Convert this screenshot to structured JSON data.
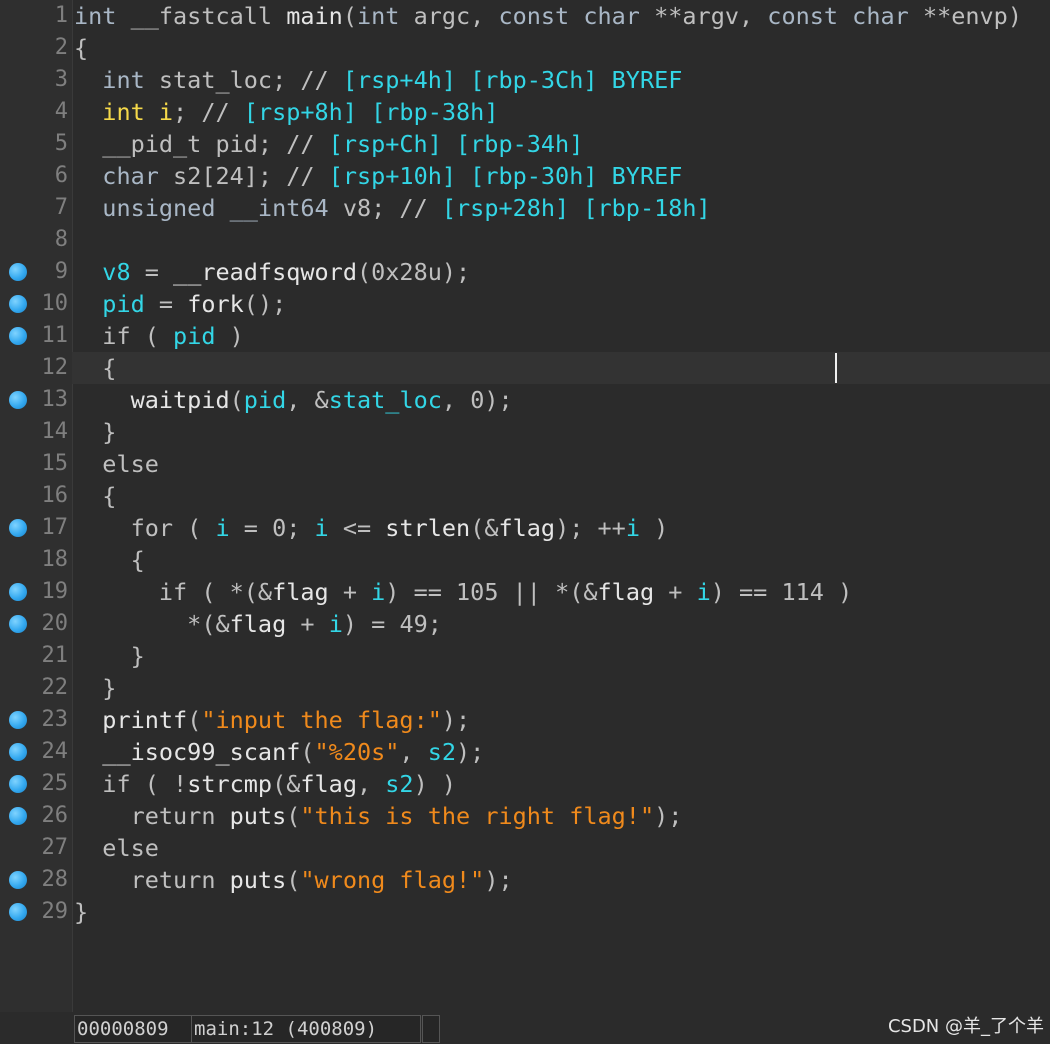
{
  "editor": {
    "lines": [
      {
        "n": "1",
        "bp": false,
        "tokens": [
          [
            "kw",
            "int "
          ],
          [
            "plain",
            "__fastcall "
          ],
          [
            "fn",
            "main"
          ],
          [
            "plain",
            "("
          ],
          [
            "kw",
            "int "
          ],
          [
            "plain",
            "argc, "
          ],
          [
            "kw",
            "const char "
          ],
          [
            "plain",
            "**argv, "
          ],
          [
            "kw",
            "const char "
          ],
          [
            "plain",
            "**envp)"
          ]
        ]
      },
      {
        "n": "2",
        "bp": false,
        "tokens": [
          [
            "plain",
            "{"
          ]
        ]
      },
      {
        "n": "3",
        "bp": false,
        "tokens": [
          [
            "plain",
            "  "
          ],
          [
            "kw",
            "int "
          ],
          [
            "plain",
            "stat_loc; // "
          ],
          [
            "addr",
            "[rsp+4h] [rbp-3Ch] BYREF"
          ]
        ]
      },
      {
        "n": "4",
        "bp": false,
        "tokens": [
          [
            "plain",
            "  "
          ],
          [
            "yel",
            "int i"
          ],
          [
            "plain",
            "; // "
          ],
          [
            "addr",
            "[rsp+8h] [rbp-38h]"
          ]
        ]
      },
      {
        "n": "5",
        "bp": false,
        "tokens": [
          [
            "plain",
            "  __pid_t pid; // "
          ],
          [
            "addr",
            "[rsp+Ch] [rbp-34h]"
          ]
        ]
      },
      {
        "n": "6",
        "bp": false,
        "tokens": [
          [
            "plain",
            "  "
          ],
          [
            "kw",
            "char "
          ],
          [
            "plain",
            "s2[24]; // "
          ],
          [
            "addr",
            "[rsp+10h] [rbp-30h] BYREF"
          ]
        ]
      },
      {
        "n": "7",
        "bp": false,
        "tokens": [
          [
            "plain",
            "  "
          ],
          [
            "kw",
            "unsigned __int64 "
          ],
          [
            "plain",
            "v8; // "
          ],
          [
            "addr",
            "[rsp+28h] [rbp-18h]"
          ]
        ]
      },
      {
        "n": "8",
        "bp": false,
        "tokens": []
      },
      {
        "n": "9",
        "bp": true,
        "tokens": [
          [
            "plain",
            "  "
          ],
          [
            "var",
            "v8"
          ],
          [
            "plain",
            " = "
          ],
          [
            "fn",
            "__readfsqword"
          ],
          [
            "plain",
            "("
          ],
          [
            "num",
            "0x28u"
          ],
          [
            "plain",
            ");"
          ]
        ]
      },
      {
        "n": "10",
        "bp": true,
        "tokens": [
          [
            "plain",
            "  "
          ],
          [
            "var",
            "pid"
          ],
          [
            "plain",
            " = "
          ],
          [
            "fn",
            "fork"
          ],
          [
            "plain",
            "();"
          ]
        ]
      },
      {
        "n": "11",
        "bp": true,
        "tokens": [
          [
            "plain",
            "  if ( "
          ],
          [
            "var",
            "pid"
          ],
          [
            "plain",
            " )"
          ]
        ]
      },
      {
        "n": "12",
        "bp": false,
        "tokens": [
          [
            "plain",
            "  {"
          ]
        ]
      },
      {
        "n": "13",
        "bp": true,
        "tokens": [
          [
            "plain",
            "    "
          ],
          [
            "fn",
            "waitpid"
          ],
          [
            "plain",
            "("
          ],
          [
            "var",
            "pid"
          ],
          [
            "plain",
            ", &"
          ],
          [
            "var",
            "stat_loc"
          ],
          [
            "plain",
            ", "
          ],
          [
            "num",
            "0"
          ],
          [
            "plain",
            ");"
          ]
        ]
      },
      {
        "n": "14",
        "bp": false,
        "tokens": [
          [
            "plain",
            "  }"
          ]
        ]
      },
      {
        "n": "15",
        "bp": false,
        "tokens": [
          [
            "plain",
            "  else"
          ]
        ]
      },
      {
        "n": "16",
        "bp": false,
        "tokens": [
          [
            "plain",
            "  {"
          ]
        ]
      },
      {
        "n": "17",
        "bp": true,
        "tokens": [
          [
            "plain",
            "    for ( "
          ],
          [
            "var",
            "i"
          ],
          [
            "plain",
            " = "
          ],
          [
            "num",
            "0"
          ],
          [
            "plain",
            "; "
          ],
          [
            "var",
            "i"
          ],
          [
            "plain",
            " <= "
          ],
          [
            "fn",
            "strlen"
          ],
          [
            "plain",
            "(&"
          ],
          [
            "fn",
            "flag"
          ],
          [
            "plain",
            "); ++"
          ],
          [
            "var",
            "i"
          ],
          [
            "plain",
            " )"
          ]
        ]
      },
      {
        "n": "18",
        "bp": false,
        "tokens": [
          [
            "plain",
            "    {"
          ]
        ]
      },
      {
        "n": "19",
        "bp": true,
        "tokens": [
          [
            "plain",
            "      if ( *(&"
          ],
          [
            "fn",
            "flag"
          ],
          [
            "plain",
            " + "
          ],
          [
            "var",
            "i"
          ],
          [
            "plain",
            ") == "
          ],
          [
            "num",
            "105"
          ],
          [
            "plain",
            " || *(&"
          ],
          [
            "fn",
            "flag"
          ],
          [
            "plain",
            " + "
          ],
          [
            "var",
            "i"
          ],
          [
            "plain",
            ") == "
          ],
          [
            "num",
            "114"
          ],
          [
            "plain",
            " )"
          ]
        ]
      },
      {
        "n": "20",
        "bp": true,
        "tokens": [
          [
            "plain",
            "        *(&"
          ],
          [
            "fn",
            "flag"
          ],
          [
            "plain",
            " + "
          ],
          [
            "var",
            "i"
          ],
          [
            "plain",
            ") = "
          ],
          [
            "num",
            "49"
          ],
          [
            "plain",
            ";"
          ]
        ]
      },
      {
        "n": "21",
        "bp": false,
        "tokens": [
          [
            "plain",
            "    }"
          ]
        ]
      },
      {
        "n": "22",
        "bp": false,
        "tokens": [
          [
            "plain",
            "  }"
          ]
        ]
      },
      {
        "n": "23",
        "bp": true,
        "tokens": [
          [
            "plain",
            "  "
          ],
          [
            "fn",
            "printf"
          ],
          [
            "plain",
            "("
          ],
          [
            "str",
            "\"input the flag:\""
          ],
          [
            "plain",
            ");"
          ]
        ]
      },
      {
        "n": "24",
        "bp": true,
        "tokens": [
          [
            "plain",
            "  "
          ],
          [
            "fn",
            "__isoc99_scanf"
          ],
          [
            "plain",
            "("
          ],
          [
            "str",
            "\"%20s\""
          ],
          [
            "plain",
            ", "
          ],
          [
            "var",
            "s2"
          ],
          [
            "plain",
            ");"
          ]
        ]
      },
      {
        "n": "25",
        "bp": true,
        "tokens": [
          [
            "plain",
            "  if ( !"
          ],
          [
            "fn",
            "strcmp"
          ],
          [
            "plain",
            "(&"
          ],
          [
            "fn",
            "flag"
          ],
          [
            "plain",
            ", "
          ],
          [
            "var",
            "s2"
          ],
          [
            "plain",
            ") )"
          ]
        ]
      },
      {
        "n": "26",
        "bp": true,
        "tokens": [
          [
            "plain",
            "    return "
          ],
          [
            "fn",
            "puts"
          ],
          [
            "plain",
            "("
          ],
          [
            "str",
            "\"this is the right flag!\""
          ],
          [
            "plain",
            ");"
          ]
        ]
      },
      {
        "n": "27",
        "bp": false,
        "tokens": [
          [
            "plain",
            "  else"
          ]
        ]
      },
      {
        "n": "28",
        "bp": true,
        "tokens": [
          [
            "plain",
            "    return "
          ],
          [
            "fn",
            "puts"
          ],
          [
            "plain",
            "("
          ],
          [
            "str",
            "\"wrong flag!\""
          ],
          [
            "plain",
            ");"
          ]
        ]
      },
      {
        "n": "29",
        "bp": true,
        "tokens": [
          [
            "plain",
            "}"
          ]
        ]
      }
    ]
  },
  "status": {
    "address": "00000809",
    "location": "main:12 (400809)"
  },
  "watermark": "CSDN @羊_了个羊",
  "colors": {
    "background": "#2b2b2b",
    "variable": "#33d6e6",
    "string": "#f08a1c",
    "highlight_int": "#f5d94a",
    "breakpoint": "#34a9f0"
  }
}
